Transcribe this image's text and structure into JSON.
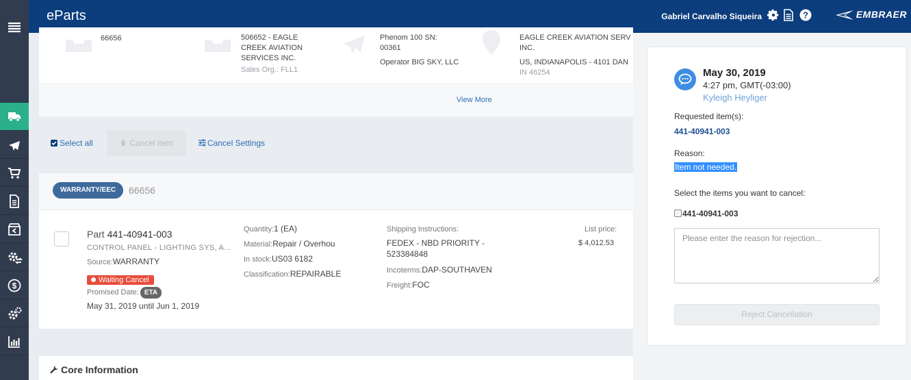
{
  "app": {
    "brand": "eParts",
    "user_name": "Gabriel Carvalho Siqueira",
    "company_logo": "EMBRAER"
  },
  "top_icons": [
    "gear-icon",
    "document-icon",
    "help-icon"
  ],
  "sidebar": {
    "items": [
      {
        "icon": "truck-icon",
        "active": true
      },
      {
        "icon": "airplane-icon",
        "active": false
      },
      {
        "icon": "cart-icon",
        "active": false
      },
      {
        "icon": "document-icon",
        "active": false
      },
      {
        "icon": "return-box-icon",
        "active": false
      },
      {
        "icon": "exchange-gear-icon",
        "active": false
      },
      {
        "icon": "dollar-icon",
        "active": false
      },
      {
        "icon": "gears-icon",
        "active": false
      },
      {
        "icon": "bar-chart-icon",
        "active": false
      }
    ]
  },
  "order_info": {
    "order_number": "66656",
    "customer": {
      "line1": "506652 - EAGLE",
      "line2": "CREEK AVIATION",
      "line3": "SERVICES INC.",
      "sales_org": "Sales Org.: FLL1"
    },
    "aircraft": {
      "line1": "Phenom 100 SN:",
      "line2": "00361",
      "operator": "Operator BIG SKY, LLC"
    },
    "address": {
      "line1": "EAGLE CREEK AVIATION SERV",
      "line2": "INC.",
      "line3": "US, INDIANAPOLIS - 4101 DAN",
      "line4": "IN 46254"
    },
    "view_more": "View More"
  },
  "toolbar": {
    "select_all": "Select all",
    "cancel_item": "Cancel item",
    "cancel_settings": "Cancel Settings"
  },
  "item": {
    "type_badge": "WARRANTY/EEC",
    "order_number": "66656",
    "part_label": "Part",
    "part_number": "441-40941-003",
    "description": "CONTROL PANEL - LIGHTING SYS, A...",
    "source_label": "Source:",
    "source": "WARRANTY",
    "status": "Waiting Cancel",
    "promised_label": "Promised Date:",
    "eta": "ETA",
    "promised_range": "May 31, 2019 until Jun 1, 2019",
    "quantity_label": "Quantity:",
    "quantity": "1 (EA)",
    "material_label": "Material:",
    "material": "Repair / Overhou",
    "stock_label": "In stock:",
    "stock": "US03 6182",
    "classification_label": "Classification:",
    "classification": "REPAIRABLE",
    "shipping_label": "Shipping Instructions:",
    "shipping_line1": "FEDEX - NBD PRIORITY -",
    "shipping_line2": "523384848",
    "incoterms_label": "Incoterms:",
    "incoterms": "DAP-SOUTHAVEN",
    "freight_label": "Freight:",
    "freight": "FOC",
    "list_price_label": "List price:",
    "list_price": "$ 4,012.53"
  },
  "core": {
    "title": "Core Information"
  },
  "cancel_request": {
    "date": "May 30, 2019",
    "time": "4:27 pm, GMT(-03:00)",
    "requester": "Kyleigh Heyliger",
    "requested_items_label": "Requested item(s):",
    "requested_item": "441-40941-003",
    "reason_label": "Reason:",
    "reason": "Item not needed.",
    "select_label": "Select the items you want to cancel:",
    "checkbox_item": "441-40941-003",
    "rejection_placeholder": "Please enter the reason for rejection...",
    "reject_button": "Reject Cancellation"
  },
  "colors": {
    "topbar": "#0c3d7d",
    "sidebar": "#323c4f",
    "sidebar_active": "#2bb08b",
    "status_red": "#e74c3c",
    "link": "#2d6fb5"
  }
}
